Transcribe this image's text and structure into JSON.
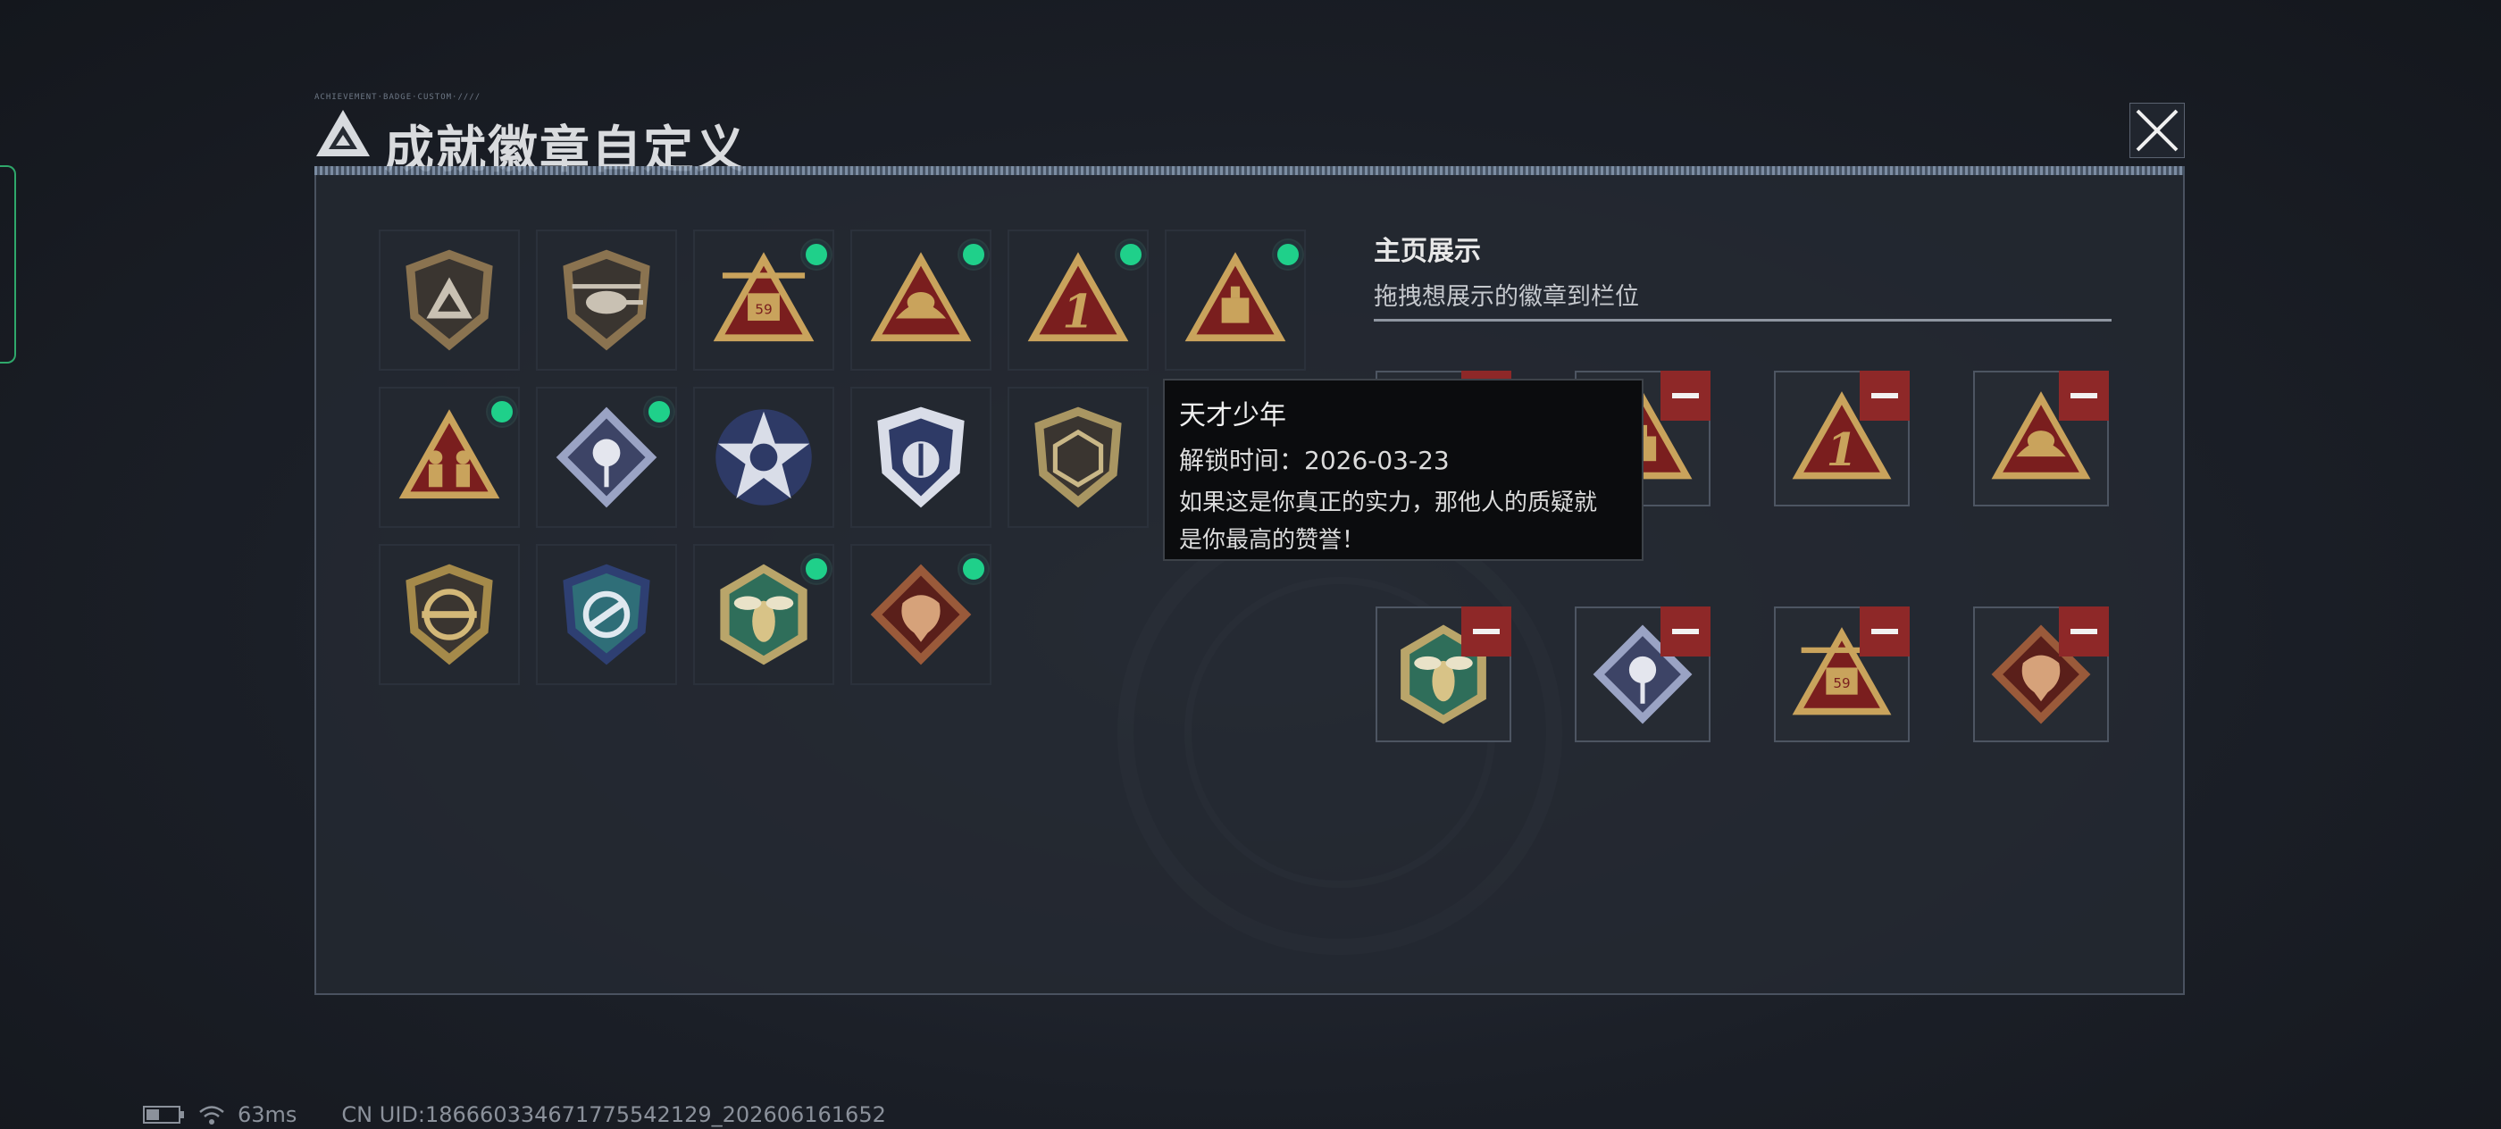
{
  "title": {
    "text": "成就徽章自定义",
    "deco_text": "ACHIEVEMENT·BADGE·CUSTOM·////"
  },
  "close": {
    "icon": "close-icon"
  },
  "colors": {
    "accent_green": "#1fd08a",
    "remove_red": "#8e2828",
    "badge_gold": "#c9a35c",
    "badge_red": "#7a1e1e"
  },
  "badges": [
    {
      "icon": "shield-logo-badge",
      "new": false
    },
    {
      "icon": "helicopter-badge",
      "new": false
    },
    {
      "icon": "cargo-59-badge",
      "new": true
    },
    {
      "icon": "golden-crown-badge",
      "new": true
    },
    {
      "icon": "number-one-badge",
      "new": true
    },
    {
      "icon": "supply-drop-badge",
      "new": true
    },
    {
      "icon": "squad-badge",
      "new": true
    },
    {
      "icon": "rose-diamond-badge",
      "new": true
    },
    {
      "icon": "star-eagle-badge",
      "new": false
    },
    {
      "icon": "wing-shield-badge",
      "new": false
    },
    {
      "icon": "d20-dice-badge",
      "new": false
    },
    {
      "icon": "green-rifle-badge",
      "new": false
    },
    {
      "icon": "gold-rifle-badge",
      "new": false
    },
    {
      "icon": "blue-knife-badge",
      "new": false
    },
    {
      "icon": "hornet-badge",
      "new": true
    },
    {
      "icon": "dragon-badge",
      "new": true
    }
  ],
  "display": {
    "title": "主页展示",
    "subtitle": "拖拽想展示的徽章到栏位",
    "slots": [
      {
        "icon": "squad-badge"
      },
      {
        "icon": "supply-drop-badge"
      },
      {
        "icon": "number-one-badge"
      },
      {
        "icon": "golden-crown-badge"
      },
      {
        "icon": "hornet-badge"
      },
      {
        "icon": "rose-diamond-badge"
      },
      {
        "icon": "cargo-59-badge"
      },
      {
        "icon": "dragon-badge"
      }
    ]
  },
  "tooltip": {
    "name": "天才少年",
    "unlock_time": "解锁时间：2026-03-23",
    "desc_line1": "如果这是你真正的实力，那他人的质疑就",
    "desc_line2": "是你最高的赞誉！"
  },
  "status": {
    "ping": "63ms",
    "uid": "CN UID:1866603346717755421​29_202606161652",
    "battery_icon": "battery-icon",
    "wifi_icon": "wifi-icon"
  }
}
